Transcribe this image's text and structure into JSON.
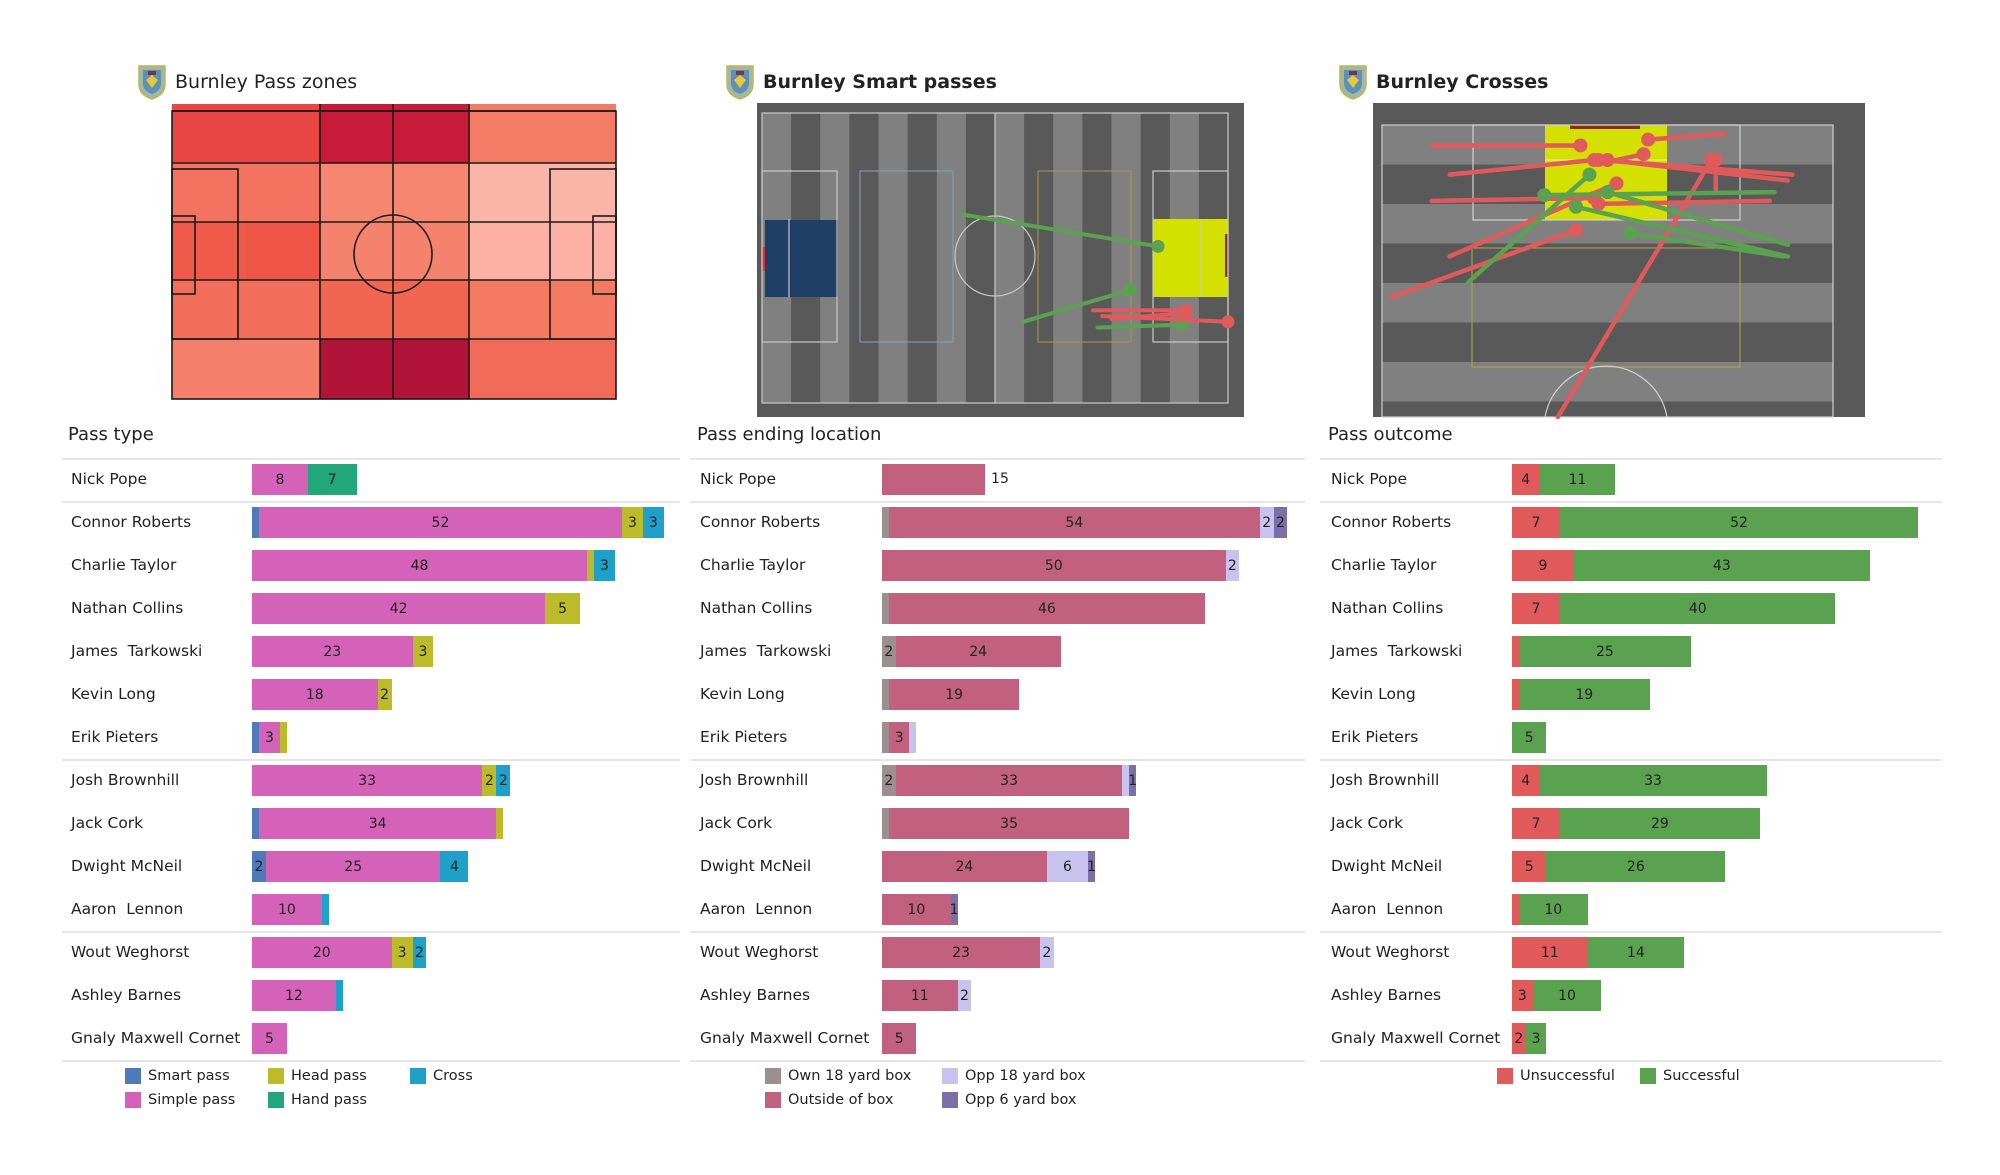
{
  "colors": {
    "smart_pass": "#4e79bb",
    "simple_pass": "#d462b8",
    "head_pass": "#bcbc2a",
    "hand_pass": "#22a77b",
    "cross": "#1fa0c8",
    "own_18": "#9b8f8f",
    "outside_box": "#c2617f",
    "opp_18": "#c8c2ee",
    "opp_6": "#7b6fa8",
    "unsuccessful": "#e05a5c",
    "successful": "#5aa150",
    "pitch_dark": "#595959",
    "pitch_light": "#808080",
    "highlight_yellow": "#d4e000",
    "highlight_blue": "#1f3f66"
  },
  "panels": {
    "pass_zones": {
      "title": "Burnley Pass zones"
    },
    "smart_passes": {
      "title": "Burnley Smart passes"
    },
    "crosses": {
      "title": "Burnley Crosses"
    }
  },
  "chart_data": [
    {
      "type": "heatmap",
      "title": "Burnley Pass zones",
      "grid": {
        "rows": 5,
        "cols": 6
      },
      "description": "Pitch divided into 5 horizontal lanes; outer lanes split into 3 columns (left third, middle third, right third), inner lanes into 6 zones",
      "zones": [
        {
          "row": 1,
          "cols": [
            1,
            2
          ],
          "color": "#e84545"
        },
        {
          "row": 1,
          "cols": [
            3,
            4
          ],
          "color": "#c81b3a"
        },
        {
          "row": 1,
          "cols": [
            5,
            6
          ],
          "color": "#f47b66"
        },
        {
          "row": 2,
          "cols": [
            1,
            2
          ],
          "color": "#f47260"
        },
        {
          "row": 2,
          "cols": [
            3,
            4
          ],
          "color": "#f6866f"
        },
        {
          "row": 2,
          "cols": [
            5,
            6
          ],
          "color": "#fbb5a8"
        },
        {
          "row": 3,
          "cols": [
            1,
            1
          ],
          "color": "#ef5a4a"
        },
        {
          "row": 3,
          "cols": [
            2,
            2
          ],
          "color": "#ee5547"
        },
        {
          "row": 3,
          "cols": [
            3,
            4
          ],
          "color": "#f5826c"
        },
        {
          "row": 3,
          "cols": [
            5,
            6
          ],
          "color": "#fcb1a4"
        },
        {
          "row": 4,
          "cols": [
            1,
            2
          ],
          "color": "#f26e5a"
        },
        {
          "row": 4,
          "cols": [
            3,
            4
          ],
          "color": "#f16652"
        },
        {
          "row": 4,
          "cols": [
            5,
            6
          ],
          "color": "#f47a64"
        },
        {
          "row": 5,
          "cols": [
            1,
            2
          ],
          "color": "#f47f6a"
        },
        {
          "row": 5,
          "cols": [
            3,
            4
          ],
          "color": "#b11339"
        },
        {
          "row": 5,
          "cols": [
            5,
            6
          ],
          "color": "#f26a58"
        }
      ]
    },
    {
      "type": "scatter",
      "title": "Burnley Smart passes",
      "units": "pitch coordinates 0-100 (x: own goal to opponent goal, y: top to bottom)",
      "passes": [
        {
          "start": [
            43,
            35
          ],
          "end": [
            85,
            46
          ],
          "outcome": "successful"
        },
        {
          "start": [
            56,
            72
          ],
          "end": [
            79,
            61
          ],
          "outcome": "successful"
        },
        {
          "start": [
            72,
            74
          ],
          "end": [
            90,
            73
          ],
          "outcome": "successful"
        },
        {
          "start": [
            71,
            68
          ],
          "end": [
            91,
            68
          ],
          "outcome": "unsuccessful"
        },
        {
          "start": [
            75,
            71
          ],
          "end": [
            91,
            69
          ],
          "outcome": "unsuccessful"
        },
        {
          "start": [
            73,
            70
          ],
          "end": [
            100,
            72
          ],
          "outcome": "unsuccessful"
        }
      ]
    },
    {
      "type": "scatter",
      "title": "Burnley Crosses",
      "units": "pixel-free half-pitch coordinates 0-100 (x: left to right, y: goal line to halfway)",
      "passes": [
        {
          "start": [
            11,
            7
          ],
          "end": [
            44,
            7
          ],
          "outcome": "unsuccessful"
        },
        {
          "start": [
            76,
            3
          ],
          "end": [
            59,
            5
          ],
          "outcome": "unsuccessful"
        },
        {
          "start": [
            15,
            17
          ],
          "end": [
            47,
            12
          ],
          "outcome": "unsuccessful"
        },
        {
          "start": [
            49,
            13
          ],
          "end": [
            58,
            10
          ],
          "outcome": "unsuccessful"
        },
        {
          "start": [
            91,
            17
          ],
          "end": [
            48,
            12
          ],
          "outcome": "unsuccessful"
        },
        {
          "start": [
            90,
            19
          ],
          "end": [
            50,
            12
          ],
          "outcome": "unsuccessful"
        },
        {
          "start": [
            11,
            26
          ],
          "end": [
            47,
            25
          ],
          "outcome": "unsuccessful"
        },
        {
          "start": [
            86,
            26
          ],
          "end": [
            48,
            27
          ],
          "outcome": "unsuccessful"
        },
        {
          "start": [
            15,
            45
          ],
          "end": [
            52,
            20
          ],
          "outcome": "unsuccessful"
        },
        {
          "start": [
            74,
            22
          ],
          "end": [
            74,
            12
          ],
          "outcome": "unsuccessful"
        },
        {
          "start": [
            39,
            100
          ],
          "end": [
            73,
            12
          ],
          "outcome": "unsuccessful"
        },
        {
          "start": [
            2,
            59
          ],
          "end": [
            43,
            36
          ],
          "outcome": "unsuccessful"
        },
        {
          "start": [
            19,
            54
          ],
          "end": [
            46,
            17
          ],
          "outcome": "successful"
        },
        {
          "start": [
            87,
            23
          ],
          "end": [
            36,
            24
          ],
          "outcome": "successful"
        },
        {
          "start": [
            90,
            41
          ],
          "end": [
            50,
            23
          ],
          "outcome": "successful"
        },
        {
          "start": [
            90,
            45
          ],
          "end": [
            43,
            28
          ],
          "outcome": "successful"
        },
        {
          "start": [
            89,
            45
          ],
          "end": [
            55,
            37
          ],
          "outcome": "successful"
        }
      ]
    },
    {
      "type": "bar",
      "stacked": true,
      "orientation": "horizontal",
      "title": "Pass type",
      "categories": [
        "Nick Pope",
        "Connor Roberts",
        "Charlie Taylor",
        "Nathan Collins",
        "James  Tarkowski",
        "Kevin Long",
        "Erik Pieters",
        "Josh Brownhill",
        "Jack Cork",
        "Dwight McNeil",
        "Aaron  Lennon",
        "Wout Weghorst",
        "Ashley Barnes",
        "Gnaly Maxwell Cornet"
      ],
      "groups_after_index": [
        0,
        6,
        10
      ],
      "series": [
        {
          "name": "Smart pass",
          "key": "smart_pass",
          "values": [
            0,
            1,
            0,
            0,
            0,
            0,
            1,
            0,
            1,
            2,
            0,
            0,
            0,
            0
          ]
        },
        {
          "name": "Simple pass",
          "key": "simple_pass",
          "values": [
            8,
            52,
            48,
            42,
            23,
            18,
            3,
            33,
            34,
            25,
            10,
            20,
            12,
            5
          ]
        },
        {
          "name": "Head pass",
          "key": "head_pass",
          "values": [
            0,
            3,
            1,
            5,
            3,
            2,
            1,
            2,
            1,
            0,
            0,
            3,
            0,
            0
          ]
        },
        {
          "name": "Hand pass",
          "key": "hand_pass",
          "values": [
            7,
            0,
            0,
            0,
            0,
            0,
            0,
            0,
            0,
            0,
            0,
            0,
            0,
            0
          ]
        },
        {
          "name": "Cross",
          "key": "cross",
          "values": [
            0,
            3,
            3,
            0,
            0,
            0,
            0,
            2,
            0,
            4,
            1,
            2,
            1,
            0
          ]
        }
      ],
      "legend": {
        "placement": "bottom",
        "items": [
          {
            "label": "Smart pass",
            "key": "smart_pass"
          },
          {
            "label": "Head pass",
            "key": "head_pass"
          },
          {
            "label": "Cross",
            "key": "cross"
          },
          {
            "label": "Simple pass",
            "key": "simple_pass"
          },
          {
            "label": "Hand pass",
            "key": "hand_pass"
          }
        ]
      }
    },
    {
      "type": "bar",
      "stacked": true,
      "orientation": "horizontal",
      "title": "Pass ending location",
      "categories": [
        "Nick Pope",
        "Connor Roberts",
        "Charlie Taylor",
        "Nathan Collins",
        "James  Tarkowski",
        "Kevin Long",
        "Erik Pieters",
        "Josh Brownhill",
        "Jack Cork",
        "Dwight McNeil",
        "Aaron  Lennon",
        "Wout Weghorst",
        "Ashley Barnes",
        "Gnaly Maxwell Cornet"
      ],
      "groups_after_index": [
        0,
        6,
        10
      ],
      "series": [
        {
          "name": "Own 18 yard box",
          "key": "own_18",
          "values": [
            0,
            1,
            0,
            1,
            2,
            1,
            1,
            2,
            1,
            0,
            0,
            0,
            0,
            0
          ]
        },
        {
          "name": "Outside of box",
          "key": "outside_box",
          "values": [
            15,
            54,
            50,
            46,
            24,
            19,
            3,
            33,
            35,
            24,
            10,
            23,
            11,
            5
          ]
        },
        {
          "name": "Opp 18 yard box",
          "key": "opp_18",
          "values": [
            0,
            2,
            2,
            0,
            0,
            0,
            1,
            1,
            0,
            6,
            0,
            2,
            2,
            0
          ]
        },
        {
          "name": "Opp 6 yard box",
          "key": "opp_6",
          "values": [
            0,
            2,
            0,
            0,
            0,
            0,
            0,
            1,
            0,
            1,
            1,
            0,
            0,
            0
          ]
        }
      ],
      "outside_label_index": [
        0
      ],
      "legend": {
        "placement": "bottom",
        "items": [
          {
            "label": "Own 18 yard box",
            "key": "own_18"
          },
          {
            "label": "Opp 18 yard box",
            "key": "opp_18"
          },
          {
            "label": "Outside of box",
            "key": "outside_box"
          },
          {
            "label": "Opp 6 yard box",
            "key": "opp_6"
          }
        ]
      }
    },
    {
      "type": "bar",
      "stacked": true,
      "orientation": "horizontal",
      "title": "Pass outcome",
      "categories": [
        "Nick Pope",
        "Connor Roberts",
        "Charlie Taylor",
        "Nathan Collins",
        "James  Tarkowski",
        "Kevin Long",
        "Erik Pieters",
        "Josh Brownhill",
        "Jack Cork",
        "Dwight McNeil",
        "Aaron  Lennon",
        "Wout Weghorst",
        "Ashley Barnes",
        "Gnaly Maxwell Cornet"
      ],
      "groups_after_index": [
        0,
        6,
        10
      ],
      "series": [
        {
          "name": "Unsuccessful",
          "key": "unsuccessful",
          "values": [
            4,
            7,
            9,
            7,
            1,
            1,
            0,
            4,
            7,
            5,
            1,
            11,
            3,
            2
          ]
        },
        {
          "name": "Successful",
          "key": "successful",
          "values": [
            11,
            52,
            43,
            40,
            25,
            19,
            5,
            33,
            29,
            26,
            10,
            14,
            10,
            3
          ]
        }
      ],
      "legend": {
        "placement": "bottom",
        "items": [
          {
            "label": "Unsuccessful",
            "key": "unsuccessful"
          },
          {
            "label": "Successful",
            "key": "successful"
          }
        ]
      }
    }
  ]
}
